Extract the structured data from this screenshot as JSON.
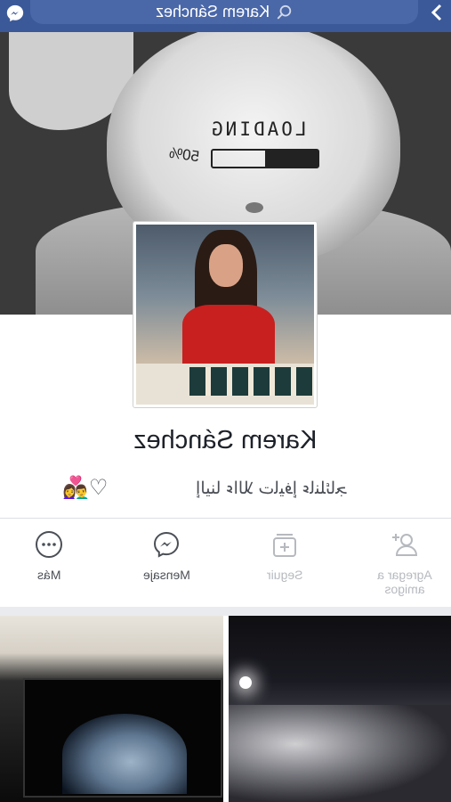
{
  "header": {
    "search_text": "Karem Sánchez",
    "icons": {
      "search": "search-icon",
      "messenger": "messenger-icon",
      "back": "chevron-left-icon"
    },
    "color": "#3b5998"
  },
  "cover": {
    "overlay_text": "LOADING",
    "overlay_percent": "50%",
    "progress_fraction": 0.5
  },
  "profile": {
    "name": "Karem Sánchez",
    "bio_text": "ﺇﻟﻴﻨﺎ ﺀﺍﻟﻼ ﺕﺎﻴﻓﺇ ﺀﺎﻨﻠﺋﺎﺠ",
    "bio_emoji": "👩‍❤️‍👨♡"
  },
  "actions": [
    {
      "label": "Agregar a amigos",
      "icon": "add-friend-icon",
      "enabled": false
    },
    {
      "label": "Seguir",
      "icon": "follow-icon",
      "enabled": false
    },
    {
      "label": "Mensaje",
      "icon": "messenger-icon",
      "enabled": true
    },
    {
      "label": "Más",
      "icon": "more-icon",
      "enabled": true
    }
  ]
}
